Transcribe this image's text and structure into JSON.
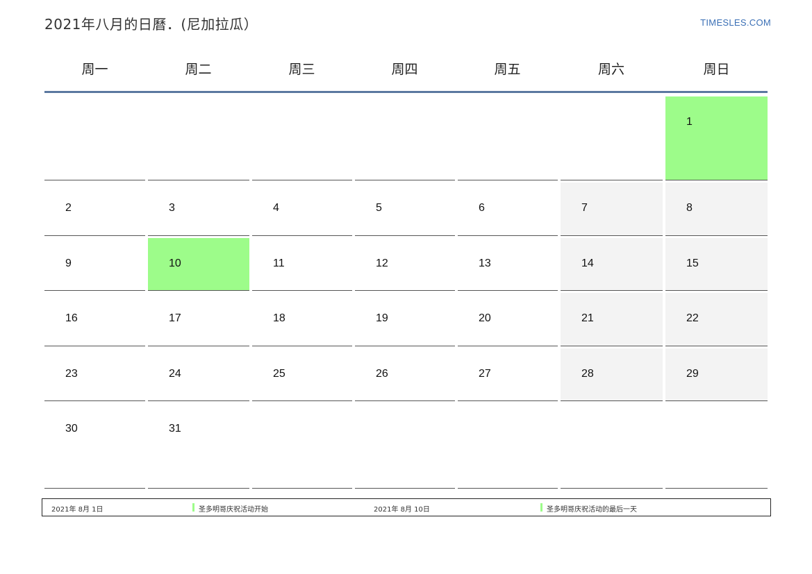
{
  "header": {
    "title": "2021年八月的日曆．(尼加拉瓜）",
    "site": "TIMESLES.COM"
  },
  "weekdays": [
    "周一",
    "周二",
    "周三",
    "周四",
    "周五",
    "周六",
    "周日"
  ],
  "weeks": [
    [
      "",
      "",
      "",
      "",
      "",
      "",
      "1"
    ],
    [
      "2",
      "3",
      "4",
      "5",
      "6",
      "7",
      "8"
    ],
    [
      "9",
      "10",
      "11",
      "12",
      "13",
      "14",
      "15"
    ],
    [
      "16",
      "17",
      "18",
      "19",
      "20",
      "21",
      "22"
    ],
    [
      "23",
      "24",
      "25",
      "26",
      "27",
      "28",
      "29"
    ],
    [
      "30",
      "31",
      "",
      "",
      "",
      "",
      ""
    ]
  ],
  "holiday_days": [
    "1",
    "10"
  ],
  "colors": {
    "holiday": "#9dfc8a",
    "weekend": "#f3f3f3",
    "header_rule": "#5b78a0",
    "site_link": "#3a6fb5"
  },
  "legend": [
    {
      "date": "2021年 8月 1日",
      "text": "圣多明哥庆祝活动开始"
    },
    {
      "date": "2021年 8月 10日",
      "text": "圣多明哥庆祝活动的最后一天"
    }
  ]
}
